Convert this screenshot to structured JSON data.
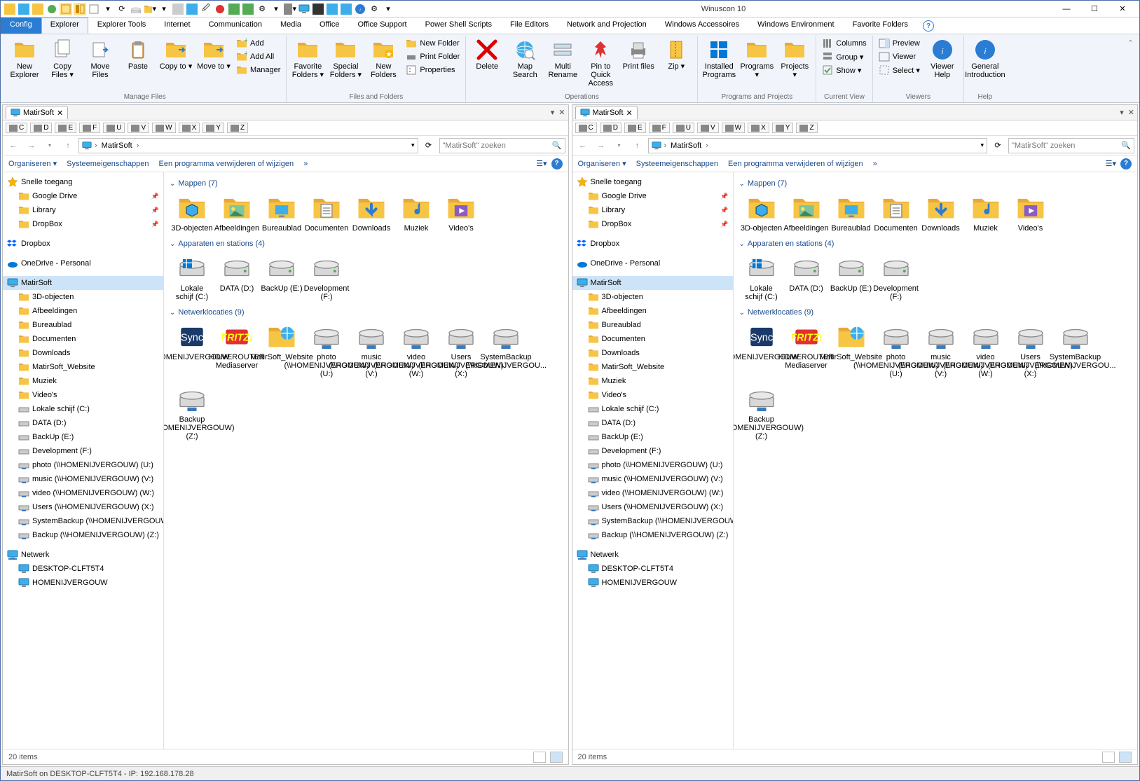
{
  "app": {
    "title": "Winuscon 10",
    "status_bar": "MatirSoft on DESKTOP-CLFT5T4 - IP: 192.168.178.28"
  },
  "ribbon": {
    "tabs": [
      "Config",
      "Explorer",
      "Explorer Tools",
      "Internet",
      "Communication",
      "Media",
      "Office",
      "Office Support",
      "Power Shell Scripts",
      "File Editors",
      "Network and Projection",
      "Windows Accessoires",
      "Windows Environment",
      "Favorite Folders"
    ],
    "active_tab": 1,
    "groups": {
      "manage_files": {
        "label": "Manage Files",
        "new_explorer": "New Explorer",
        "copy_files": "Copy Files ▾",
        "move_files": "Move Files",
        "paste": "Paste",
        "copy_to": "Copy to ▾",
        "move_to": "Move to ▾",
        "add": "Add",
        "add_all": "Add All",
        "manager": "Manager"
      },
      "files_folders": {
        "label": "Files and Folders",
        "favorite_folders": "Favorite Folders ▾",
        "special_folders": "Special Folders ▾",
        "new_folders": "New Folders",
        "new_folder": "New Folder",
        "print_folder": "Print Folder",
        "properties": "Properties"
      },
      "operations": {
        "label": "Operations",
        "delete": "Delete",
        "map_search": "Map Search",
        "multi_rename": "Multi Rename",
        "pin_quick": "Pin to Quick Access",
        "print_files": "Print files",
        "zip": "Zip ▾"
      },
      "programs_projects": {
        "label": "Programs and Projects",
        "installed": "Installed Programs",
        "programs": "Programs ▾",
        "projects": "Projects ▾"
      },
      "current_view": {
        "label": "Current View",
        "columns": "Columns",
        "group": "Group ▾",
        "show": "Show ▾"
      },
      "viewers": {
        "label": "Viewers",
        "preview": "Preview",
        "viewer": "Viewer",
        "select": "Select ▾",
        "viewer_help": "Viewer Help"
      },
      "help": {
        "label": "Help",
        "general": "General Introduction"
      }
    }
  },
  "pane": {
    "tab_label": "MatirSoft",
    "drives": [
      "C",
      "D",
      "E",
      "F",
      "U",
      "V",
      "W",
      "X",
      "Y",
      "Z"
    ],
    "breadcrumb": [
      "MatirSoft"
    ],
    "search_placeholder": "\"MatirSoft\" zoeken",
    "toolbar": {
      "organiseren": "Organiseren ▾",
      "sys_props": "Systeemeigenschappen",
      "uninstall": "Een programma verwijderen of wijzigen",
      "more": "»"
    },
    "tree_quick": "Snelle toegang",
    "tree_quick_items": [
      "Google Drive",
      "Library",
      "DropBox"
    ],
    "tree_dropbox": "Dropbox",
    "tree_onedrive": "OneDrive - Personal",
    "tree_thispc": "MatirSoft",
    "tree_thispc_items": [
      "3D-objecten",
      "Afbeeldingen",
      "Bureaublad",
      "Documenten",
      "Downloads",
      "MatirSoft_Website",
      "Muziek",
      "Video's",
      "Lokale schijf (C:)",
      "DATA (D:)",
      "BackUp (E:)",
      "Development (F:)",
      "photo (\\\\HOMENIJVERGOUW) (U:)",
      "music (\\\\HOMENIJVERGOUW) (V:)",
      "video (\\\\HOMENIJVERGOUW) (W:)",
      "Users (\\\\HOMENIJVERGOUW) (X:)",
      "SystemBackup (\\\\HOMENIJVERGOUW) (Y:)",
      "Backup (\\\\HOMENIJVERGOUW) (Z:)"
    ],
    "tree_network": "Netwerk",
    "tree_network_items": [
      "DESKTOP-CLFT5T4",
      "HOMENIJVERGOUW"
    ],
    "groups": [
      {
        "title": "Mappen (7)",
        "items": [
          "3D-objecten",
          "Afbeeldingen",
          "Bureaublad",
          "Documenten",
          "Downloads",
          "Muziek",
          "Video's"
        ],
        "icons": [
          "obj3d",
          "pictures",
          "desktop",
          "documents",
          "downloads",
          "music",
          "videos"
        ]
      },
      {
        "title": "Apparaten en stations (4)",
        "items": [
          "Lokale schijf (C:)",
          "DATA (D:)",
          "BackUp (E:)",
          "Development (F:)"
        ],
        "icons": [
          "cdrive",
          "hdd",
          "hdd",
          "hdd"
        ]
      },
      {
        "title": "Netwerklocaties (9)",
        "items": [
          "HOMENIJVERGOUW",
          "HOMEROUTER Mediaserver",
          "MatirSoft_Website",
          "photo (\\\\HOMENIJVERGOUW) (U:)",
          "music (\\\\HOMENIJVERGOUW) (V:)",
          "video (\\\\HOMENIJVERGOUW) (W:)",
          "Users (\\\\HOMENIJVERGOUW) (X:)",
          "SystemBackup (\\\\HOMENIJVERGOU...",
          "Backup (\\\\HOMENIJVERGOUW) (Z:)"
        ],
        "icons": [
          "synology",
          "fritz",
          "webfolder",
          "netdrv",
          "netdrv",
          "netdrv",
          "netdrv",
          "netdrv",
          "netdrv"
        ]
      }
    ],
    "status": "20 items"
  }
}
